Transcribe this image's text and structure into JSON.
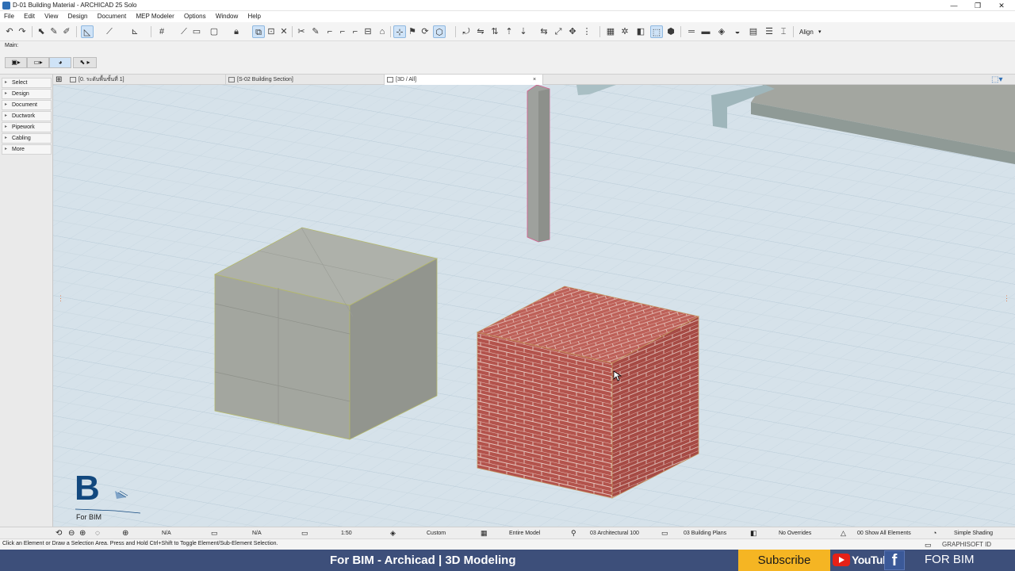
{
  "window": {
    "title": "D-01 Building Material - ARCHICAD 25 Solo",
    "min": "—",
    "max": "❐",
    "close": "✕"
  },
  "menu": [
    "File",
    "Edit",
    "View",
    "Design",
    "Document",
    "MEP Modeler",
    "Options",
    "Window",
    "Help"
  ],
  "toolbar": {
    "align_label": "Align"
  },
  "infobox": {
    "main_label": "Main:"
  },
  "toolbox": {
    "items": [
      "Select",
      "Design",
      "Document",
      "Ductwork",
      "Pipework",
      "Cabling",
      "More"
    ]
  },
  "tabs": [
    {
      "label": "[0. ระดับพื้นชั้นที่ 1]"
    },
    {
      "label": "[S-02 Building Section]"
    },
    {
      "label": "[3D / All]",
      "close": "×"
    }
  ],
  "logo": {
    "letter": "B",
    "caption": "For BIM"
  },
  "status": {
    "na1": "N/A",
    "na2": "N/A",
    "scale": "1:50",
    "custom": "Custom",
    "model": "Entire Model",
    "pen": "03 Architectural 100",
    "plans": "03 Building Plans",
    "overrides": "No Overrides",
    "renovation": "00 Show All Elements",
    "shading": "Simple Shading"
  },
  "hint": "Click an Element or Draw a Selection Area. Press and Hold Ctrl+Shift to Toggle Element/Sub-Element Selection.",
  "graphisoft": "GRAPHISOFT ID",
  "banner": {
    "title": "For BIM - Archicad  | 3D Modeling",
    "subscribe": "Subscribe",
    "youtube": "YouTube",
    "fb_letter": "f",
    "channel": "FOR BIM"
  },
  "colors": {
    "viewport_bg": "#d6e2ea",
    "banner_bg": "#3d4f7a",
    "subscribe_bg": "#f5b523",
    "brick": "#b3534c",
    "concrete": "#a7aaa3",
    "logo_blue": "#12487e"
  },
  "icons": [
    "undo-icon",
    "redo-icon",
    "arrow-select-icon",
    "pick-up-icon",
    "inject-icon",
    "measure-icon",
    "grid-icon",
    "3d-view-icon",
    "cursor-icon"
  ]
}
